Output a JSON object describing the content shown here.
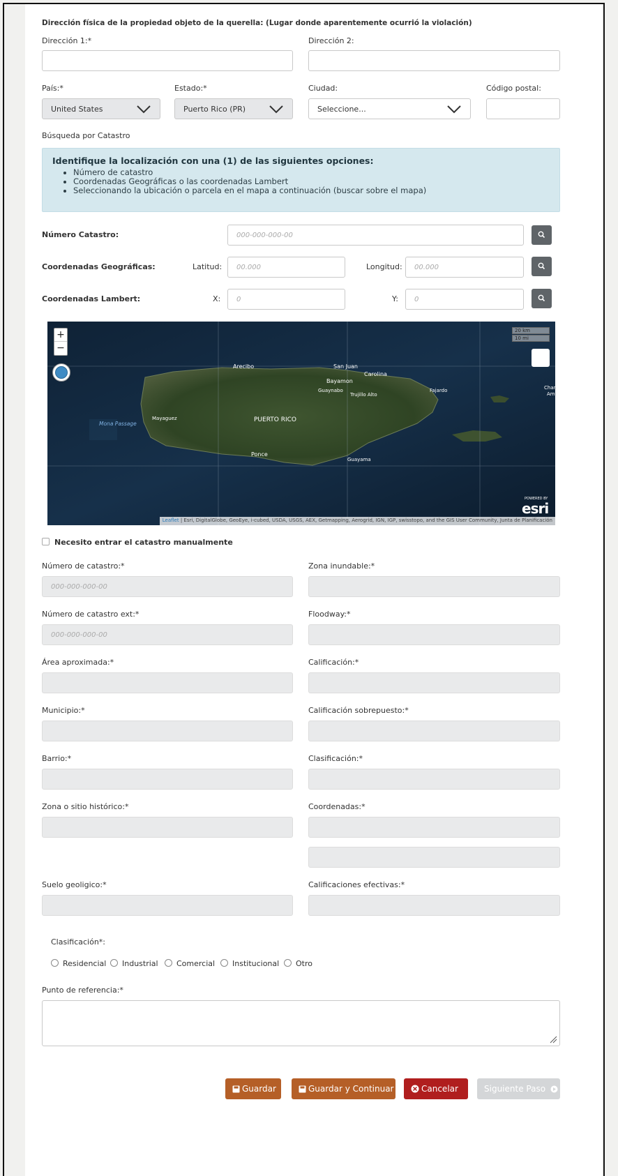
{
  "section_title": "Dirección física de la propiedad objeto de la querella: (Lugar donde aparentemente ocurrió la violación)",
  "address": {
    "dir1_label": "Dirección 1:*",
    "dir2_label": "Dirección 2:",
    "pais_label": "País:*",
    "pais_value": "United States",
    "estado_label": "Estado:*",
    "estado_value": "Puerto Rico (PR)",
    "ciudad_label": "Ciudad:",
    "ciudad_value": "Seleccione...",
    "cp_label": "Código postal:"
  },
  "catastro_search_label": "Búsqueda por Catastro",
  "info_box": {
    "title": "Identifique la localización con una (1) de las siguientes opciones:",
    "items": [
      "Número de catastro",
      "Coordenadas Geográficas o las coordenadas Lambert",
      "Seleccionando la ubicación o parcela en el mapa a continuación (buscar sobre el mapa)"
    ]
  },
  "search": {
    "catastro_label": "Número Catastro:",
    "catastro_placeholder": "000-000-000-00",
    "geo_label": "Coordenadas Geográficas:",
    "lat_label": "Latitud:",
    "lat_placeholder": "00.000",
    "lon_label": "Longitud:",
    "lon_placeholder": "00.000",
    "lambert_label": "Coordenadas Lambert:",
    "x_label": "X:",
    "x_placeholder": "0",
    "y_label": "Y:",
    "y_placeholder": "0"
  },
  "map": {
    "zoom_in": "+",
    "zoom_out": "−",
    "scale_km": "20 km",
    "scale_mi": "10 mi",
    "labels": {
      "arecibo": "Arecibo",
      "san_juan": "San Juan",
      "bayamon": "Bayamon",
      "carolina": "Carolina",
      "guaynabo": "Guaynabo",
      "trujillo": "Trujillo Alto",
      "fajardo": "Fajardo",
      "charlotte": "Charlot",
      "amalie": "Ama",
      "mona": "Mona Passage",
      "mayaguez": "Mayaguez",
      "puerto_rico": "PUERTO RICO",
      "ponce": "Ponce",
      "guayama": "Guayama"
    },
    "powered_by": "POWERED BY",
    "esri": "esri",
    "leaflet": "Leaflet",
    "attribution": "| Esri, DigitalGlobe, GeoEye, i-cubed, USDA, USGS, AEX, Getmapping, Aerogrid, IGN, IGP, swisstopo, and the GIS User Community, Junta de Planificación"
  },
  "manual_checkbox_label": "Necesito entrar el catastro manualmente",
  "fields": {
    "num_catastro_label": "Número de catastro:*",
    "num_catastro_placeholder": "000-000-000-00",
    "zona_inundable_label": "Zona inundable:*",
    "num_catastro_ext_label": "Número de catastro ext:*",
    "num_catastro_ext_placeholder": "000-000-000-00",
    "floodway_label": "Floodway:*",
    "area_label": "Área aproximada:*",
    "calificacion_label": "Calificación:*",
    "municipio_label": "Municipio:*",
    "calif_sobre_label": "Calificación sobrepuesto:*",
    "barrio_label": "Barrio:*",
    "clasificacion_label": "Clasificación:*",
    "zona_hist_label": "Zona o sitio histórico:*",
    "coordenadas_label": "Coordenadas:*",
    "suelo_label": "Suelo geoligico:*",
    "calif_efectivas_label": "Calificaciones efectivas:*"
  },
  "clasificacion_radio": {
    "label": "Clasificación*:",
    "options": [
      "Residencial",
      "Industrial",
      "Comercial",
      "Institucional",
      "Otro"
    ]
  },
  "referencia_label": "Punto de referencia:*",
  "buttons": {
    "guardar": "Guardar",
    "guardar_continuar": "Guardar y Continuar",
    "cancelar": "Cancelar",
    "siguiente": "Siguiente Paso"
  },
  "colors": {
    "brown_button": "#b55f27",
    "red_button": "#b01e1e",
    "info_bg": "#d5e8ee",
    "readonly_bg": "#e9eaeb"
  }
}
